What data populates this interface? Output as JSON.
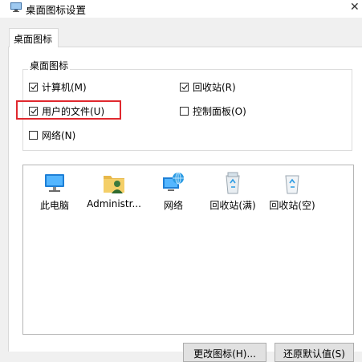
{
  "window": {
    "title": "桌面图标设置"
  },
  "tabs": [
    {
      "label": "桌面图标"
    }
  ],
  "desktop_icons_group": {
    "title": "桌面图标",
    "checkboxes": [
      {
        "label": "计算机(M)",
        "checked": true
      },
      {
        "label": "回收站(R)",
        "checked": true
      },
      {
        "label": "用户的文件(U)",
        "checked": true
      },
      {
        "label": "控制面板(O)",
        "checked": false
      },
      {
        "label": "网络(N)",
        "checked": false
      }
    ]
  },
  "icon_list": [
    {
      "label": "此电脑",
      "icon": "computer-icon"
    },
    {
      "label": "Administr...",
      "icon": "user-folder-icon"
    },
    {
      "label": "网络",
      "icon": "network-icon"
    },
    {
      "label": "回收站(满)",
      "icon": "recycle-bin-full-icon"
    },
    {
      "label": "回收站(空)",
      "icon": "recycle-bin-empty-icon"
    }
  ],
  "buttons": {
    "change_icon": "更改图标(H)...",
    "restore_default": "还原默认值(S)"
  },
  "colors": {
    "highlight_border": "#e0282e",
    "window_bg": "#f0f0f0"
  }
}
